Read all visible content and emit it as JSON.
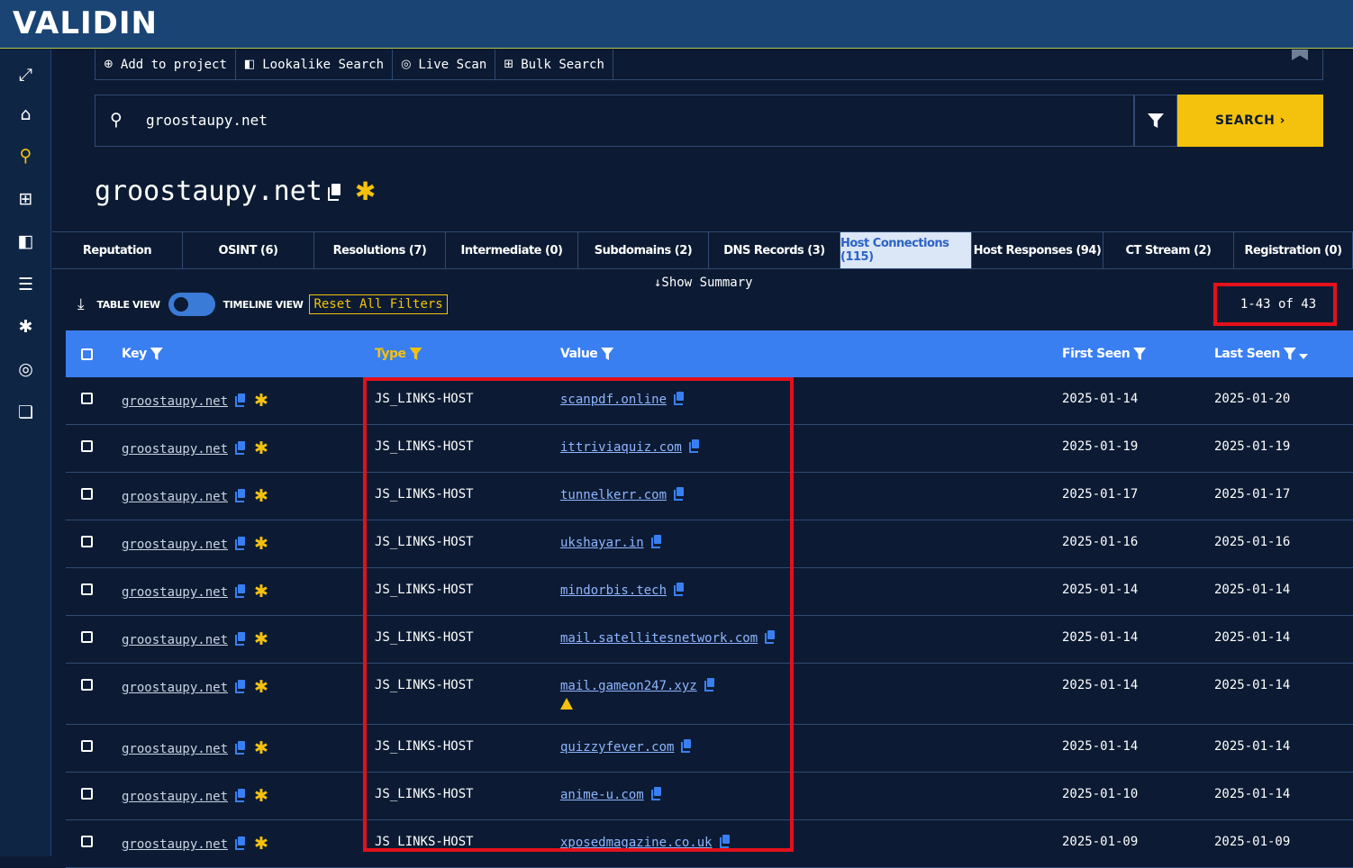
{
  "brand": {
    "logo_text": "VALIDIN"
  },
  "nav_icons": [
    "expand-icon",
    "home-icon",
    "search-icon",
    "grid-icon",
    "lookalike-icon",
    "list-icon",
    "bug-icon",
    "scan-icon",
    "library-icon"
  ],
  "actions": [
    {
      "label": "Add to project",
      "icon": "⊕"
    },
    {
      "label": "Lookalike Search",
      "icon": "◧"
    },
    {
      "label": "Live Scan",
      "icon": "◎"
    },
    {
      "label": "Bulk Search",
      "icon": "⊞"
    }
  ],
  "search": {
    "value": "groostaupy.net",
    "button_label": "SEARCH ›"
  },
  "title": {
    "domain": "groostaupy.net"
  },
  "tabs": [
    {
      "label": "Reputation",
      "w": 145
    },
    {
      "label": "OSINT (6)",
      "w": 146
    },
    {
      "label": "Resolutions (7)",
      "w": 146
    },
    {
      "label": "Intermediate (0)",
      "w": 147
    },
    {
      "label": "Subdomains (2)",
      "w": 145
    },
    {
      "label": "DNS Records (3)",
      "w": 146
    },
    {
      "label": "Host Connections (115)",
      "w": 146,
      "active": true
    },
    {
      "label": "Host Responses (94)",
      "w": 146
    },
    {
      "label": "CT Stream (2)",
      "w": 145
    },
    {
      "label": "Registration (0)",
      "w": 132
    }
  ],
  "toolbar": {
    "show_summary": "↓Show Summary",
    "table_view": "TABLE VIEW",
    "timeline_view": "TIMELINE VIEW",
    "reset_filters": "Reset All Filters",
    "page_count": "1-43 of 43"
  },
  "table": {
    "headers": {
      "key": "Key",
      "type": "Type",
      "value": "Value",
      "first_seen": "First Seen",
      "last_seen": "Last Seen"
    },
    "rows": [
      {
        "key": "groostaupy.net",
        "type": "JS_LINKS-HOST",
        "value": "scanpdf.online",
        "first": "2025-01-14",
        "last": "2025-01-20"
      },
      {
        "key": "groostaupy.net",
        "type": "JS_LINKS-HOST",
        "value": "ittriviaquiz.com",
        "first": "2025-01-19",
        "last": "2025-01-19"
      },
      {
        "key": "groostaupy.net",
        "type": "JS_LINKS-HOST",
        "value": "tunnelkerr.com",
        "first": "2025-01-17",
        "last": "2025-01-17"
      },
      {
        "key": "groostaupy.net",
        "type": "JS_LINKS-HOST",
        "value": "ukshayar.in",
        "first": "2025-01-16",
        "last": "2025-01-16"
      },
      {
        "key": "groostaupy.net",
        "type": "JS_LINKS-HOST",
        "value": "mindorbis.tech",
        "first": "2025-01-14",
        "last": "2025-01-14"
      },
      {
        "key": "groostaupy.net",
        "type": "JS_LINKS-HOST",
        "value": "mail.satellitesnetwork.com",
        "first": "2025-01-14",
        "last": "2025-01-14"
      },
      {
        "key": "groostaupy.net",
        "type": "JS_LINKS-HOST",
        "value": "mail.gameon247.xyz",
        "first": "2025-01-14",
        "last": "2025-01-14",
        "warning": true
      },
      {
        "key": "groostaupy.net",
        "type": "JS_LINKS-HOST",
        "value": "quizzyfever.com",
        "first": "2025-01-14",
        "last": "2025-01-14"
      },
      {
        "key": "groostaupy.net",
        "type": "JS_LINKS-HOST",
        "value": "anime-u.com",
        "first": "2025-01-10",
        "last": "2025-01-14"
      },
      {
        "key": "groostaupy.net",
        "type": "JS_LINKS-HOST",
        "value": "xposedmagazine.co.uk",
        "first": "2025-01-09",
        "last": "2025-01-09"
      }
    ]
  }
}
